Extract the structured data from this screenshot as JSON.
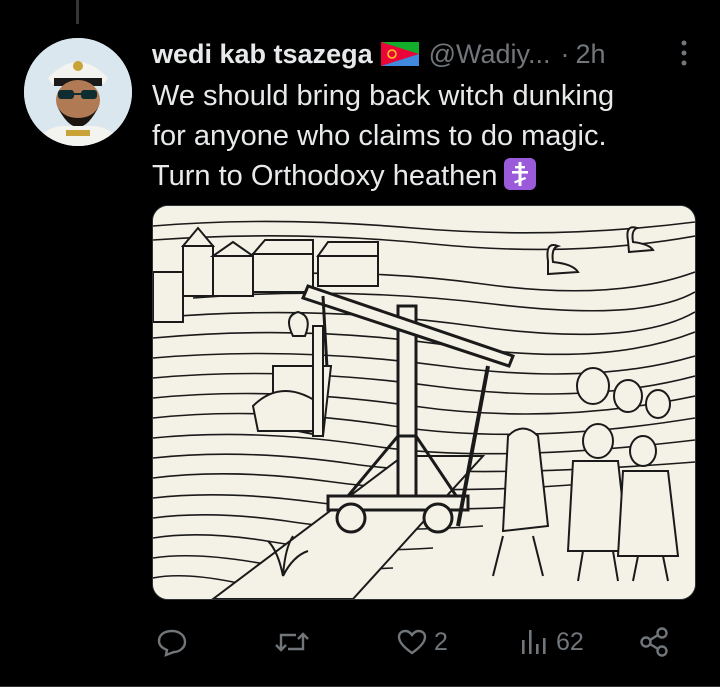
{
  "tweet": {
    "display_name": "wedi kab tsazega",
    "handle": "@Wadiy...",
    "separator": "·",
    "time": "2h",
    "text_lines": [
      "We should bring back witch dunking",
      "for anyone who claims to do magic.",
      "Turn to Orthodoxy heathen"
    ],
    "flag": "eritrea-flag",
    "emoji": "orthodox-cross-emoji",
    "media_alt": "woodcut engraving of a witch dunking"
  },
  "actions": {
    "reply_count": "",
    "retweet_count": "",
    "like_count": "2",
    "views_count": "62"
  },
  "colors": {
    "background": "#000000",
    "text": "#e7e9ea",
    "muted": "#71767b",
    "border": "#2f3336"
  }
}
